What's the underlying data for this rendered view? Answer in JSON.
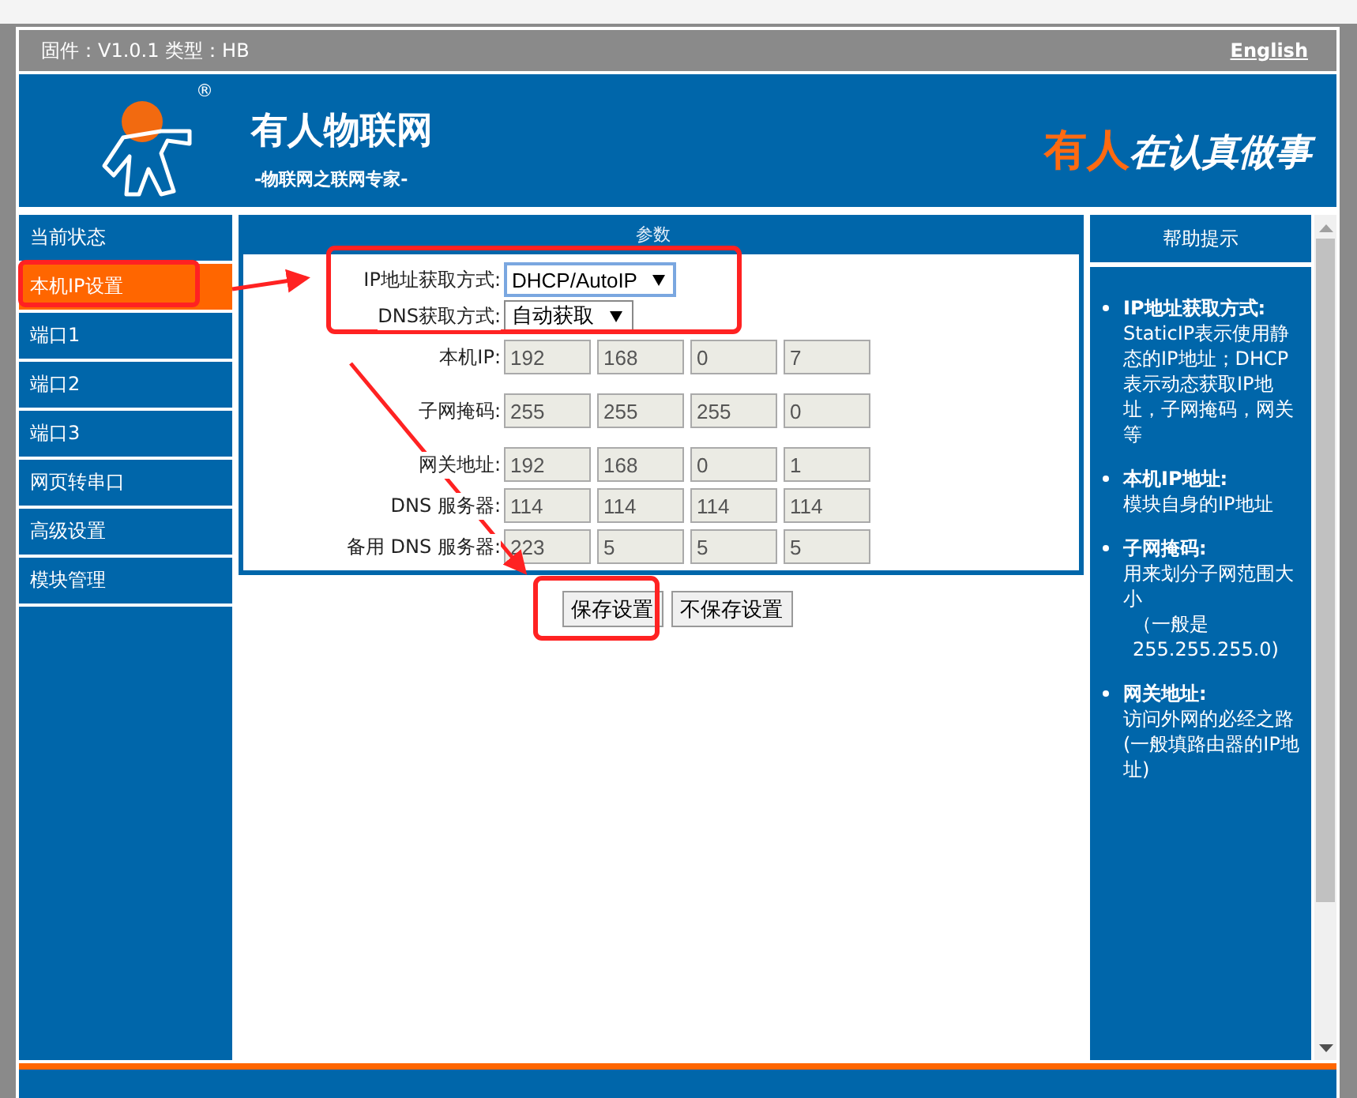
{
  "top_bar": {
    "firmware": "固件：V1.0.1 类型：HB",
    "language_link": "English"
  },
  "header": {
    "registered_mark": "®",
    "brand": "有人物联网",
    "subtitle": "-物联网之联网专家-",
    "slogan_accent": "有人",
    "slogan": "在认真做事"
  },
  "sidebar": {
    "items": [
      {
        "label": "当前状态",
        "selected": false
      },
      {
        "label": "本机IP设置",
        "selected": true
      },
      {
        "label": "端口1",
        "selected": false
      },
      {
        "label": "端口2",
        "selected": false
      },
      {
        "label": "端口3",
        "selected": false
      },
      {
        "label": "网页转串口",
        "selected": false
      },
      {
        "label": "高级设置",
        "selected": false
      },
      {
        "label": "模块管理",
        "selected": false
      }
    ]
  },
  "panel": {
    "title": "参数",
    "rows": [
      {
        "kind": "select",
        "label": "IP地址获取方式:",
        "value": "DHCP/AutoIP",
        "focused": true
      },
      {
        "kind": "select",
        "label": "DNS获取方式:",
        "value": "自动获取",
        "focused": false
      },
      {
        "kind": "ip",
        "label": "本机IP:",
        "octets": [
          "192",
          "168",
          "0",
          "7"
        ]
      },
      {
        "kind": "ip",
        "label": "子网掩码:",
        "octets": [
          "255",
          "255",
          "255",
          "0"
        ]
      },
      {
        "kind": "ip",
        "label": "网关地址:",
        "octets": [
          "192",
          "168",
          "0",
          "1"
        ]
      },
      {
        "kind": "ip",
        "label": "DNS 服务器:",
        "octets": [
          "114",
          "114",
          "114",
          "114"
        ]
      },
      {
        "kind": "ip",
        "label": "备用 DNS 服务器:",
        "octets": [
          "223",
          "5",
          "5",
          "5"
        ]
      }
    ]
  },
  "buttons": [
    "保存设置",
    "不保存设置"
  ],
  "help": {
    "title": "帮助提示",
    "items": [
      {
        "term": "IP地址获取方式:",
        "text": "StaticIP表示使用静态的IP地址；DHCP表示动态获取IP地址，子网掩码，网关等"
      },
      {
        "term": "本机IP地址:",
        "text": "模块自身的IP地址"
      },
      {
        "term": "子网掩码:",
        "text": "用来划分子网范围大小",
        "note": "（一般是255.255.255.0)"
      },
      {
        "term": "网关地址:",
        "text": "访问外网的必经之路(一般填路由器的IP地址)"
      }
    ]
  }
}
